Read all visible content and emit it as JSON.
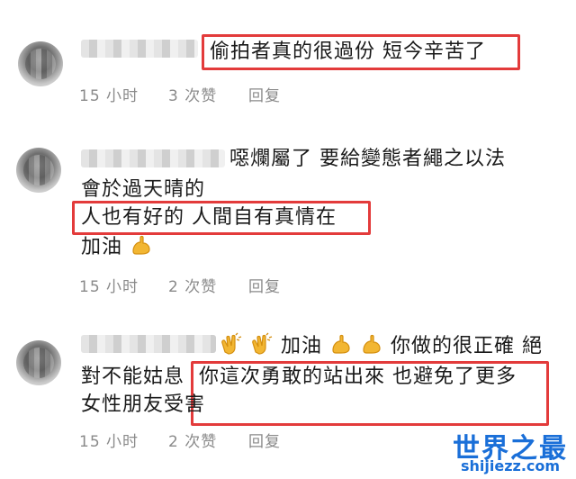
{
  "comments": [
    {
      "line1": "偷拍者真的很過份 短今辛苦了",
      "time": "15 小时",
      "likes": "3 次赞",
      "reply": "回复"
    },
    {
      "line1": "噁爛屬了 要給變態者繩之以法",
      "line2": "會於過天晴的",
      "line3": "人也有好的 人間自有真情在",
      "line4": "加油",
      "time": "15 小时",
      "likes": "2 次赞",
      "reply": "回复"
    },
    {
      "line1a": "加油",
      "line1b": "你做的很正確 絕",
      "line2a": "對不能姑息",
      "line2b": "你這次勇敢的站出來 也避免了更多",
      "line3": "女性朋友受害",
      "time": "15 小时",
      "likes": "2 次赞",
      "reply": "回复"
    }
  ],
  "watermark": {
    "title": "世界之最",
    "url": "shijiezz.com"
  },
  "colors": {
    "highlight": "#e33b3b",
    "meta": "#8a8a8a",
    "watermark": "#1a6fd8",
    "emoji": "#f2b632"
  },
  "icons": [
    "flexed-biceps-icon",
    "clapping-hands-icon"
  ]
}
